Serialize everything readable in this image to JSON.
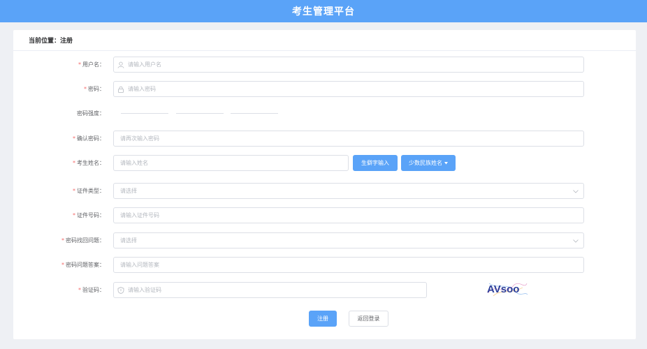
{
  "header": {
    "title": "考生管理平台"
  },
  "breadcrumb": {
    "text": "当前位置：注册"
  },
  "form": {
    "username": {
      "label": "用户名：",
      "placeholder": "请输入用户名"
    },
    "password": {
      "label": "密码：",
      "placeholder": "请输入密码"
    },
    "strength": {
      "label": "密码强度："
    },
    "confirm_password": {
      "label": "确认密码：",
      "placeholder": "请再次输入密码"
    },
    "name": {
      "label": "考生姓名：",
      "placeholder": "请输入姓名",
      "rare_char_button": "生僻字输入",
      "minority_button": "少数民族姓名"
    },
    "id_type": {
      "label": "证件类型：",
      "placeholder": "请选择"
    },
    "id_number": {
      "label": "证件号码：",
      "placeholder": "请输入证件号码"
    },
    "security_question": {
      "label": "密码找回问题：",
      "placeholder": "请选择"
    },
    "security_answer": {
      "label": "密码问题答案：",
      "placeholder": "请输入问题答案"
    },
    "captcha": {
      "label": "验证码：",
      "placeholder": "请输入验证码",
      "image_text": "AVsoo"
    }
  },
  "actions": {
    "register": "注册",
    "back_login": "返回登录"
  },
  "colors": {
    "primary": "#5aa3f8",
    "required": "#f56c6c",
    "background": "#eef0f4"
  },
  "icons": {
    "username": "user-icon",
    "password": "lock-icon",
    "captcha": "shield-icon",
    "select": "chevron-down-icon",
    "dropdown": "caret-down-icon"
  }
}
